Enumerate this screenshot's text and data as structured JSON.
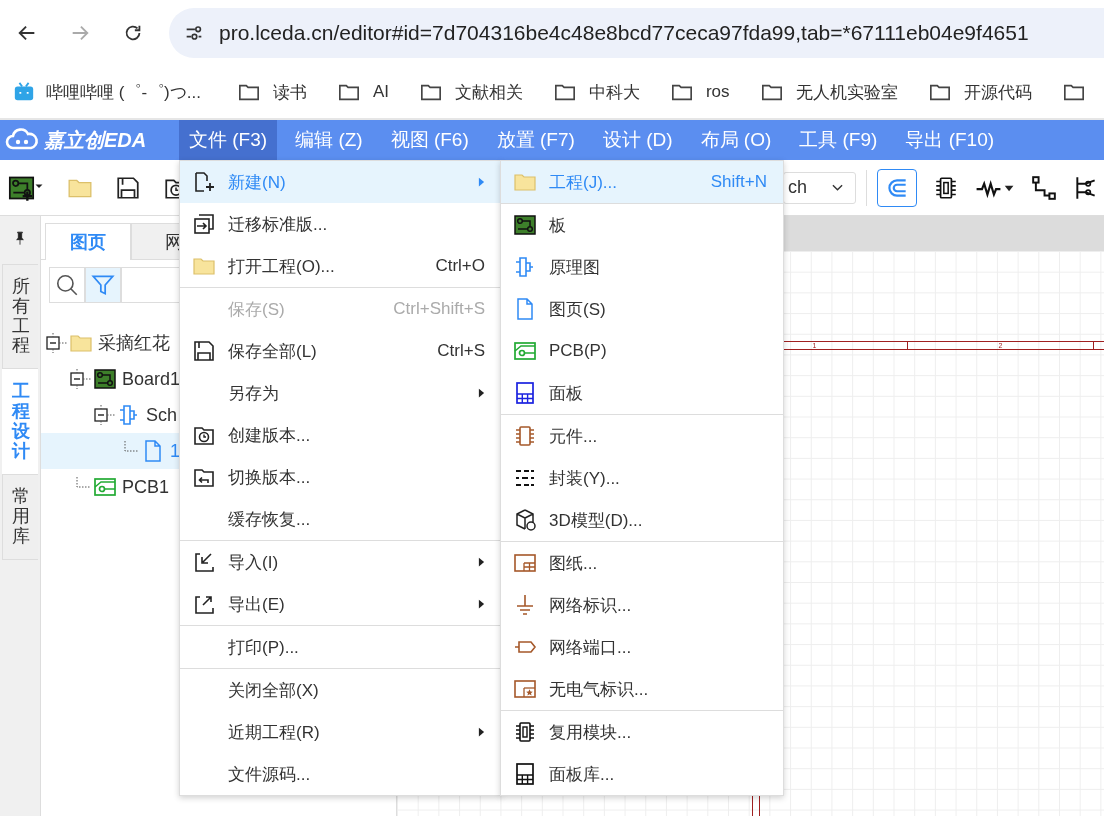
{
  "browser": {
    "url": "pro.lceda.cn/editor#id=7d704316be4c48e8bcd77ceca97fda99,tab=*67111eb04e9f4651",
    "bookmarks": [
      {
        "kind": "site",
        "label": "哔哩哔哩 (゜-゜)つ..."
      },
      {
        "kind": "folder",
        "label": "读书"
      },
      {
        "kind": "folder",
        "label": "AI"
      },
      {
        "kind": "folder",
        "label": "文献相关"
      },
      {
        "kind": "folder",
        "label": "中科大"
      },
      {
        "kind": "folder",
        "label": "ros"
      },
      {
        "kind": "folder",
        "label": "无人机实验室"
      },
      {
        "kind": "folder",
        "label": "开源代码"
      }
    ]
  },
  "app": {
    "logo": "嘉立创EDA",
    "menus": [
      {
        "label": "文件 (F3)",
        "selected": true
      },
      {
        "label": "编辑 (Z)",
        "selected": false
      },
      {
        "label": "视图 (F6)",
        "selected": false
      },
      {
        "label": "放置 (F7)",
        "selected": false
      },
      {
        "label": "设计 (D)",
        "selected": false
      },
      {
        "label": "布局 (O)",
        "selected": false
      },
      {
        "label": "工具 (F9)",
        "selected": false
      },
      {
        "label": "导出 (F10)",
        "selected": false
      }
    ]
  },
  "toolbar": {
    "select_value": "ch",
    "snap_on": true
  },
  "side_tabs": [
    {
      "label": "所有工程",
      "selected": false
    },
    {
      "label": "工程设计",
      "selected": true
    },
    {
      "label": "常用库",
      "selected": false
    }
  ],
  "panel": {
    "tabs": [
      {
        "label": "图页",
        "selected": true
      },
      {
        "label": "网",
        "selected": false
      }
    ],
    "filter_on": true
  },
  "tree": [
    {
      "label": "采摘红花",
      "kind": "folder",
      "expanded": true,
      "selected": false,
      "children": [
        {
          "label": "Board1",
          "kind": "board",
          "expanded": true,
          "selected": false,
          "children": [
            {
              "label": "Sch",
              "kind": "schematic",
              "expanded": true,
              "selected": false,
              "children": [
                {
                  "label": "1",
                  "kind": "page",
                  "selected": true
                }
              ]
            }
          ]
        },
        {
          "label": "PCB1",
          "kind": "pcb",
          "selected": false
        }
      ]
    }
  ],
  "canvas": {
    "zones": [
      "1",
      "2"
    ]
  },
  "file_menu": {
    "groups": [
      [
        {
          "label": "新建(N)",
          "kind": "new",
          "has_submenu": true,
          "disabled": false,
          "selected": true
        },
        {
          "label": "迁移标准版...",
          "kind": "migrate",
          "has_submenu": false,
          "disabled": false,
          "selected": false
        },
        {
          "label": "打开工程(O)...",
          "shortcut": "Ctrl+O",
          "kind": "folder",
          "has_submenu": false,
          "disabled": false,
          "selected": false
        }
      ],
      [
        {
          "label": "保存(S)",
          "shortcut": "Ctrl+Shift+S",
          "has_submenu": false,
          "disabled": true,
          "selected": false
        },
        {
          "label": "保存全部(L)",
          "shortcut": "Ctrl+S",
          "kind": "save",
          "has_submenu": false,
          "disabled": false,
          "selected": false
        },
        {
          "label": "另存为",
          "has_submenu": true,
          "disabled": false,
          "selected": false
        },
        {
          "label": "创建版本...",
          "kind": "version",
          "has_submenu": false,
          "disabled": false,
          "selected": false
        },
        {
          "label": "切换版本...",
          "kind": "switch",
          "has_submenu": false,
          "disabled": false,
          "selected": false
        },
        {
          "label": "缓存恢复...",
          "has_submenu": false,
          "disabled": false,
          "selected": false
        }
      ],
      [
        {
          "label": "导入(I)",
          "kind": "import",
          "has_submenu": true,
          "disabled": false,
          "selected": false
        },
        {
          "label": "导出(E)",
          "kind": "export",
          "has_submenu": true,
          "disabled": false,
          "selected": false
        }
      ],
      [
        {
          "label": "打印(P)...",
          "has_submenu": false,
          "disabled": false,
          "selected": false
        }
      ],
      [
        {
          "label": "关闭全部(X)",
          "has_submenu": false,
          "disabled": false,
          "selected": false
        },
        {
          "label": "近期工程(R)",
          "has_submenu": true,
          "disabled": false,
          "selected": false
        },
        {
          "label": "文件源码...",
          "has_submenu": false,
          "disabled": false,
          "selected": false
        }
      ]
    ]
  },
  "new_submenu": {
    "groups": [
      [
        {
          "label": "工程(J)...",
          "shortcut": "Shift+N",
          "kind": "folder",
          "selected": true
        }
      ],
      [
        {
          "label": "板",
          "kind": "board",
          "selected": false
        },
        {
          "label": "原理图",
          "kind": "schematic",
          "selected": false
        },
        {
          "label": "图页(S)",
          "kind": "page",
          "selected": false
        },
        {
          "label": "PCB(P)",
          "kind": "pcb",
          "selected": false
        },
        {
          "label": "面板",
          "kind": "panel",
          "selected": false
        }
      ],
      [
        {
          "label": "元件...",
          "kind": "component",
          "selected": false
        },
        {
          "label": "封装(Y)...",
          "kind": "footprint",
          "selected": false
        },
        {
          "label": "3D模型(D)...",
          "kind": "cube",
          "selected": false
        }
      ],
      [
        {
          "label": "图纸...",
          "kind": "sheet",
          "selected": false
        },
        {
          "label": "网络标识...",
          "kind": "ground",
          "selected": false
        },
        {
          "label": "网络端口...",
          "kind": "port",
          "selected": false
        },
        {
          "label": "无电气标识...",
          "kind": "star",
          "selected": false
        }
      ],
      [
        {
          "label": "复用模块...",
          "kind": "module",
          "selected": false
        },
        {
          "label": "面板库...",
          "kind": "panellib",
          "selected": false
        }
      ]
    ]
  }
}
